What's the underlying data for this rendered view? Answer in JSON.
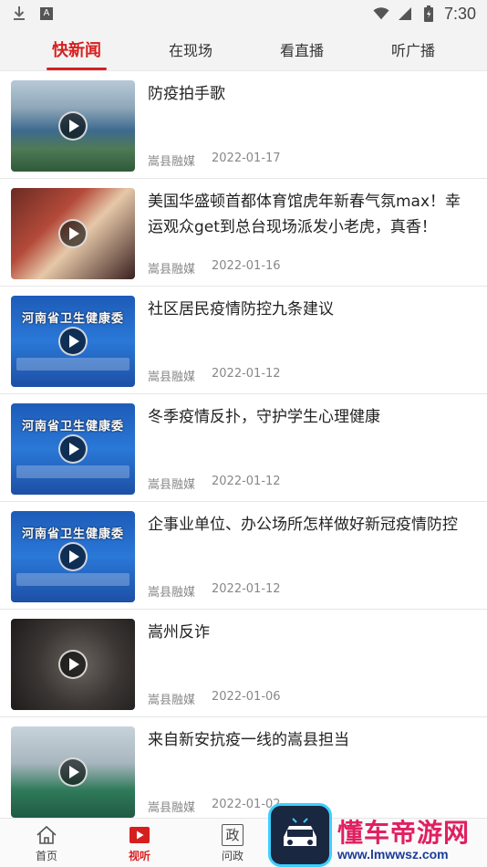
{
  "status_bar": {
    "time": "7:30",
    "left_icons": [
      "download-icon",
      "a-icon"
    ],
    "right_icons": [
      "wifi-icon",
      "signal-icon",
      "battery-icon"
    ]
  },
  "top_tabs": [
    {
      "label": "快新闻",
      "active": true
    },
    {
      "label": "在现场",
      "active": false
    },
    {
      "label": "看直播",
      "active": false
    },
    {
      "label": "听广播",
      "active": false
    }
  ],
  "news": [
    {
      "title": "防疫拍手歌",
      "source": "嵩县融媒",
      "date": "2022-01-17",
      "thumb_text": ""
    },
    {
      "title": "美国华盛顿首都体育馆虎年新春气氛max！幸运观众get到总台现场派发小老虎，真香！",
      "source": "嵩县融媒",
      "date": "2022-01-16",
      "thumb_text": ""
    },
    {
      "title": "社区居民疫情防控九条建议",
      "source": "嵩县融媒",
      "date": "2022-01-12",
      "thumb_text": "河南省卫生健康委"
    },
    {
      "title": "冬季疫情反扑，守护学生心理健康",
      "source": "嵩县融媒",
      "date": "2022-01-12",
      "thumb_text": "河南省卫生健康委"
    },
    {
      "title": "企事业单位、办公场所怎样做好新冠疫情防控",
      "source": "嵩县融媒",
      "date": "2022-01-12",
      "thumb_text": "河南省卫生健康委"
    },
    {
      "title": "嵩州反诈",
      "source": "嵩县融媒",
      "date": "2022-01-06",
      "thumb_text": ""
    },
    {
      "title": "来自新安抗疫一线的嵩县担当",
      "source": "嵩县融媒",
      "date": "2022-01-02",
      "thumb_text": ""
    }
  ],
  "bottom_nav": [
    {
      "label": "首页",
      "icon": "home-icon",
      "active": false
    },
    {
      "label": "视听",
      "icon": "video-icon",
      "active": true
    },
    {
      "label": "问政",
      "icon": "zheng-icon",
      "icon_text": "政",
      "active": false
    }
  ],
  "watermark": {
    "big": "懂车帝游网",
    "small": "www.lmwwsz.com"
  },
  "colors": {
    "accent": "#d62020",
    "meta": "#888888"
  }
}
